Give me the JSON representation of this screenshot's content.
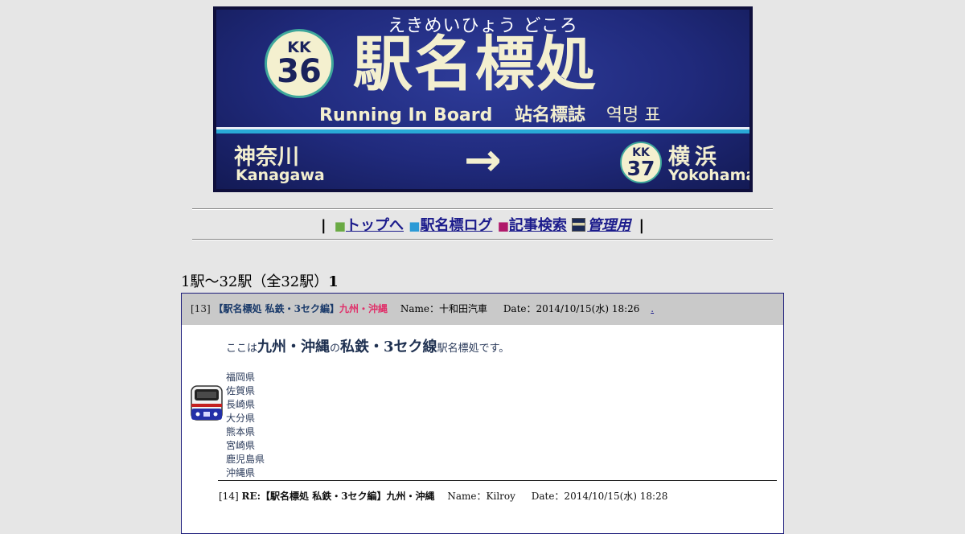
{
  "banner": {
    "kana": "えきめいひょう どころ",
    "line_code": "KK",
    "station_number": "36",
    "title": "駅名標処",
    "subtitle_en": "Running In Board",
    "subtitle_zh": "站名標誌",
    "subtitle_ko": "역명 표",
    "prev_station": "神奈川",
    "prev_station_roman": "Kanagawa",
    "arrow": "→",
    "next_line_code": "KK",
    "next_station_number": "37",
    "next_station": "横浜",
    "next_station_roman": "Yokohama",
    "colors": {
      "board": "#202a7c",
      "text": "#f3efcf",
      "stripe": "#29a9d6",
      "badge_ring": "#3fa79b"
    }
  },
  "nav": {
    "separator": "|",
    "items": [
      {
        "bullet": "■",
        "bullet_color": "#6aaa44",
        "label": "トップへ"
      },
      {
        "bullet": "■",
        "bullet_color": "#2b9ad6",
        "label": "駅名標ログ"
      },
      {
        "bullet": "■",
        "bullet_color": "#b0186a",
        "label": "記事検索"
      },
      {
        "icon": "admin-icon",
        "label": "管理用"
      }
    ]
  },
  "counter": {
    "text": "1駅～32駅（全32駅）",
    "page": "1"
  },
  "thread": {
    "number": "[13]",
    "title": "【駅名標処 私鉄・3セク編】",
    "category": "九州・沖縄",
    "author": "Name：十和田汽車",
    "date": "Date：2014/10/15(水) 18:26",
    "link": ".",
    "avatar_icon": "train-icon",
    "intro_pre": "ここは",
    "intro_region": "九州・沖縄",
    "intro_mid": "の",
    "intro_kind": "私鉄・3セク線",
    "intro_post": "駅名標処です。",
    "prefectures": [
      "福岡県",
      "佐賀県",
      "長崎県",
      "大分県",
      "熊本県",
      "宮崎県",
      "鹿児島県",
      "沖縄県"
    ],
    "reply": {
      "number": "[14]",
      "title": "RE:【駅名標処 私鉄・3セク編】九州・沖縄",
      "author": "Name：Kilroy",
      "date": "Date：2014/10/15(水) 18:28"
    }
  }
}
